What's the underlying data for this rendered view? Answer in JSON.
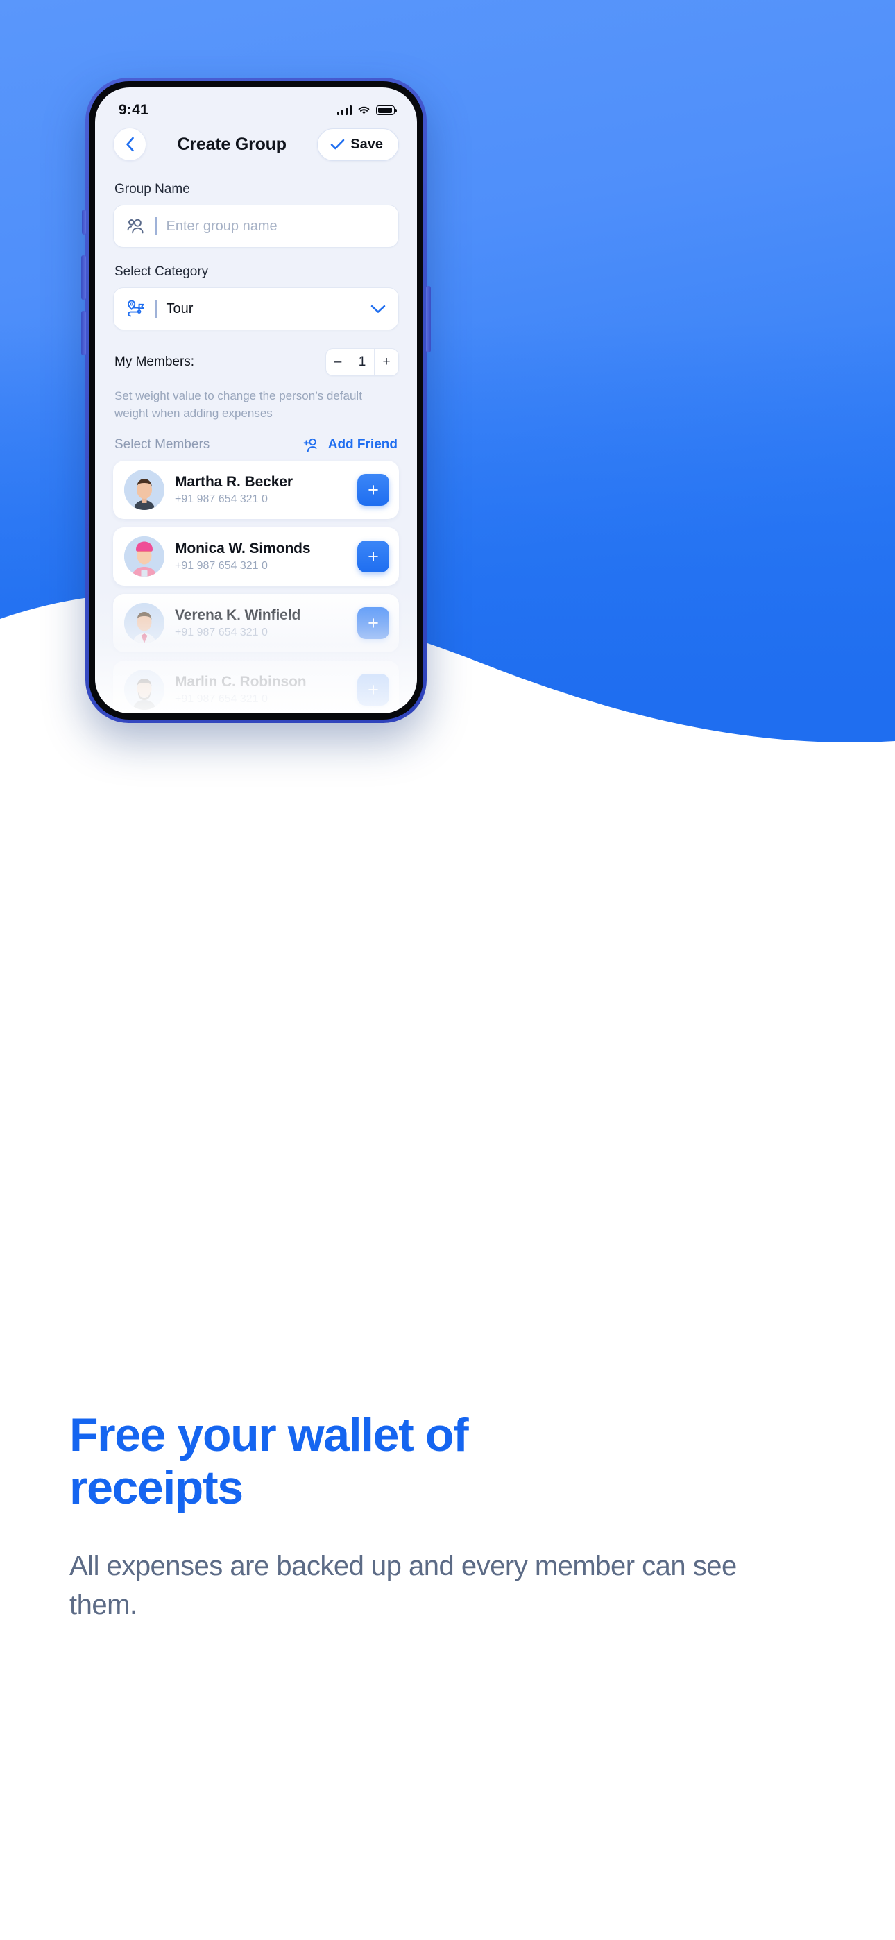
{
  "statusbar": {
    "time": "9:41",
    "signal_icon": "cellular-signal-icon",
    "wifi_icon": "wifi-icon",
    "battery_icon": "battery-full-icon"
  },
  "header": {
    "back_icon": "chevron-left-icon",
    "title": "Create Group",
    "save_label": "Save",
    "save_icon": "check-icon"
  },
  "form": {
    "group_name_label": "Group Name",
    "group_name_value": "",
    "group_name_placeholder": "Enter group name",
    "group_name_icon": "people-icon",
    "category_label": "Select Category",
    "category_value": "Tour",
    "category_icon": "route-pin-icon",
    "category_chevron": "chevron-down-icon"
  },
  "members": {
    "label": "My Members:",
    "stepper_decrement": "–",
    "stepper_value": "1",
    "stepper_increment": "+",
    "hint": "Set weight value to change the person’s default weight when adding expenses",
    "select_members_label": "Select Members",
    "add_friend_label": "Add Friend",
    "add_friend_icon": "person-add-icon",
    "add_button_label": "+"
  },
  "contacts": [
    {
      "name": "Martha R. Becker",
      "phone": "+91 987 654 321 0",
      "avatar": "man-dark-shirt"
    },
    {
      "name": "Monica W. Simonds",
      "phone": "+91 987 654 321 0",
      "avatar": "woman-pink-beanie"
    },
    {
      "name": "Verena K. Winfield",
      "phone": "+91 987 654 321 0",
      "avatar": "man-white-shirt-tie"
    },
    {
      "name": "Marlin C. Robinson",
      "phone": "+91 987 654 321 0",
      "avatar": "man-beard"
    },
    {
      "name": "",
      "phone": "",
      "avatar": "hidden-partial"
    }
  ],
  "marketing": {
    "headline": "Free your wallet of receipts",
    "subtext": "All expenses are backed up and every member can see them."
  },
  "colors": {
    "brand_blue": "#1f6ef0",
    "hero_top": "#5a97fb",
    "hero_bottom": "#2a74f0",
    "headline_blue": "#1565f0",
    "subtext_gray": "#5c6b86",
    "screen_bg": "#eff2fa"
  }
}
